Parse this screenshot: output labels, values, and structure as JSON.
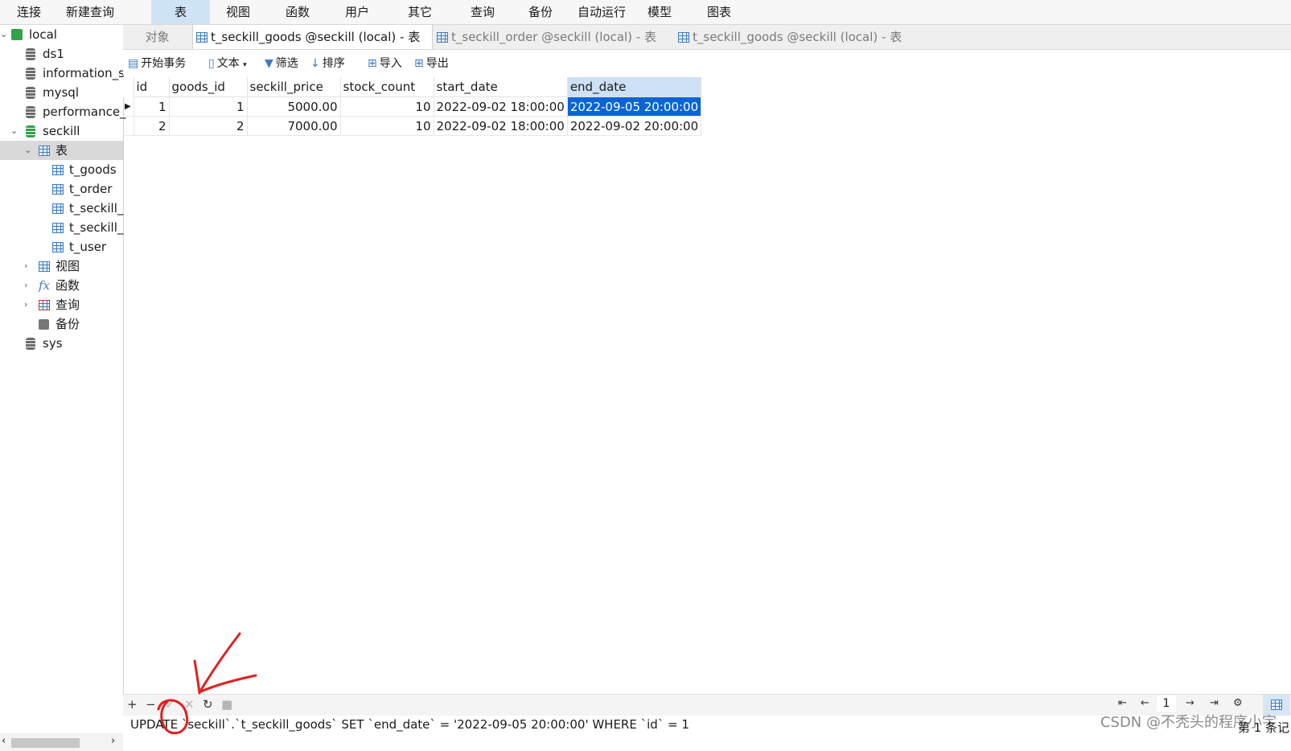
{
  "menu": [
    "连接",
    "新建查询",
    "表",
    "视图",
    "函数",
    "用户",
    "其它",
    "查询",
    "备份",
    "自动运行",
    "模型",
    "图表"
  ],
  "sidebar": {
    "connection": "local",
    "databases": [
      "ds1",
      "information_s",
      "mysql",
      "performance_"
    ],
    "active_db": "seckill",
    "tables_group": "表",
    "tables": [
      "t_goods",
      "t_order",
      "t_seckill_",
      "t_seckill_",
      "t_user"
    ],
    "groups": [
      "视图",
      "函数",
      "查询",
      "备份"
    ],
    "extra_db": "sys"
  },
  "tabs": [
    "对象",
    "t_seckill_goods @seckill (local) - 表",
    "t_seckill_order @seckill (local) - 表",
    "t_seckill_goods @seckill (local) - 表"
  ],
  "toolbar": {
    "begin_tx": "开始事务",
    "text": "文本",
    "filter": "筛选",
    "sort": "排序",
    "import": "导入",
    "export": "导出"
  },
  "table": {
    "columns": [
      "id",
      "goods_id",
      "seckill_price",
      "stock_count",
      "start_date",
      "end_date"
    ],
    "rows": [
      [
        "1",
        "1",
        "5000.00",
        "10",
        "2022-09-02 18:00:00",
        "2022-09-05 20:00:00"
      ],
      [
        "2",
        "2",
        "7000.00",
        "10",
        "2022-09-02 18:00:00",
        "2022-09-02 20:00:00"
      ]
    ]
  },
  "status": {
    "sql": "UPDATE `seckill`.`t_seckill_goods` SET `end_date` = '2022-09-05 20:00:00' WHERE `id` = 1",
    "watermark": "CSDN @不秃头的程序小宇",
    "page": "1",
    "record": "第 1 条记"
  }
}
